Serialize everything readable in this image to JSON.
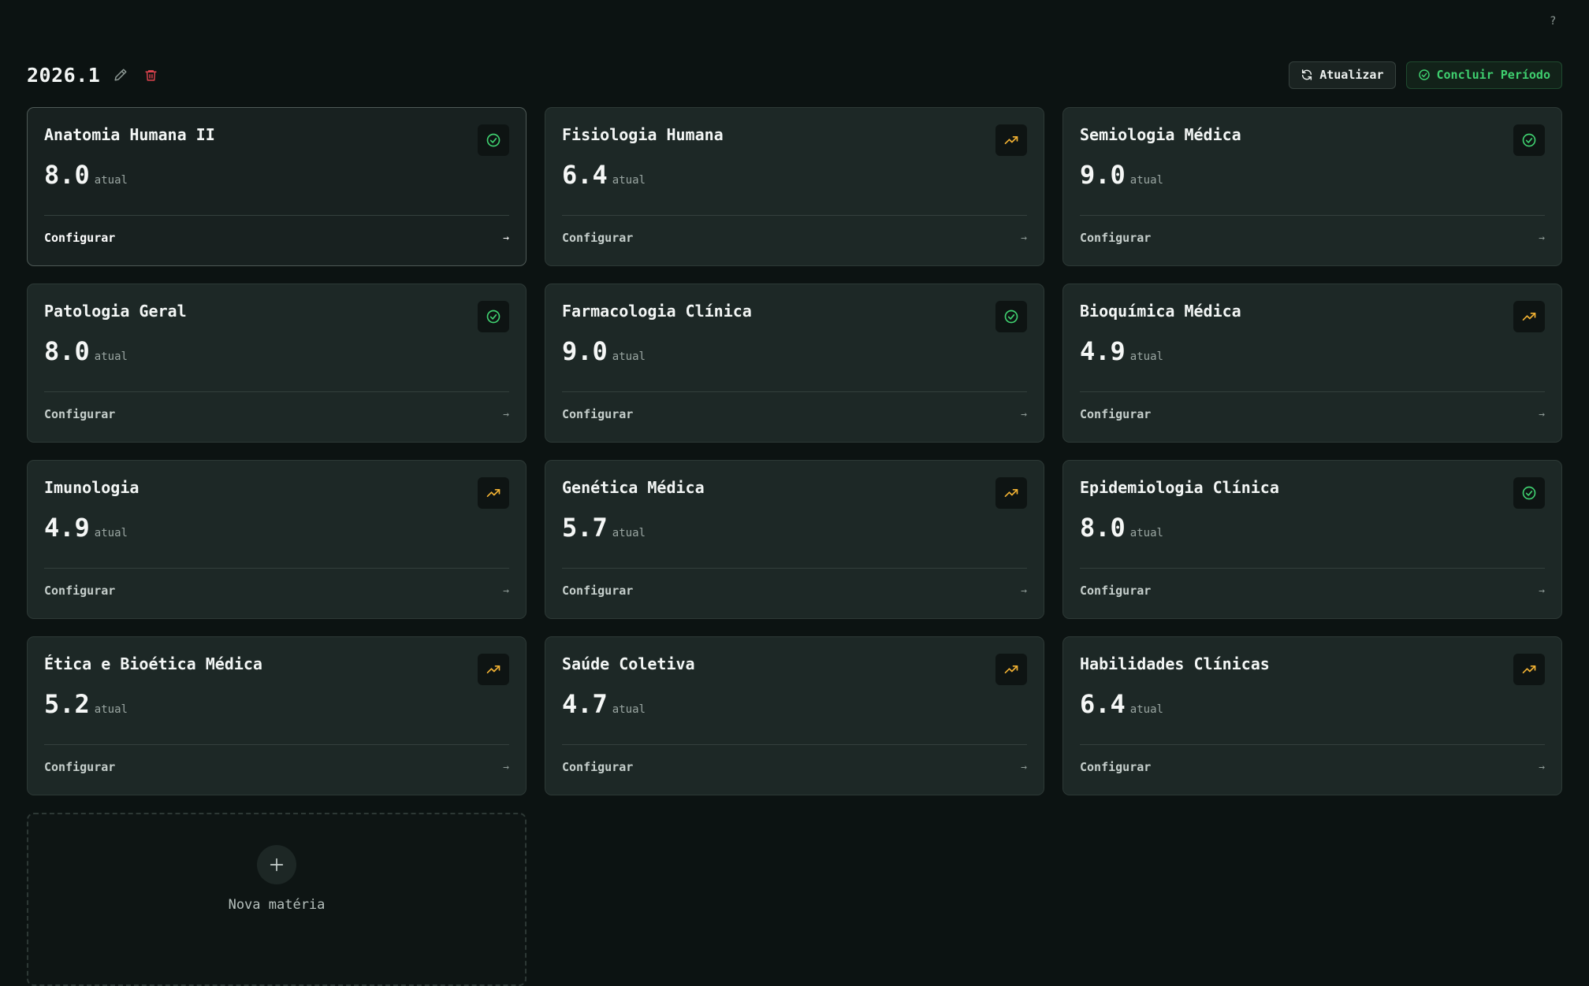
{
  "help_label": "?",
  "period": {
    "title": "2026.1"
  },
  "actions": {
    "refresh_label": "Atualizar",
    "conclude_label": "Concluir Período"
  },
  "config_label": "Configurar",
  "grade_unit": "atual",
  "colors": {
    "success": "#3fcf6f",
    "warning": "#f2b233",
    "danger": "#e0444f"
  },
  "subjects": [
    {
      "name": "Anatomia Humana II",
      "grade": "8.0",
      "status": "check-circle-icon"
    },
    {
      "name": "Fisiologia Humana",
      "grade": "6.4",
      "status": "trending-up-icon"
    },
    {
      "name": "Semiologia Médica",
      "grade": "9.0",
      "status": "check-circle-icon"
    },
    {
      "name": "Patologia Geral",
      "grade": "8.0",
      "status": "check-circle-icon"
    },
    {
      "name": "Farmacologia Clínica",
      "grade": "9.0",
      "status": "check-circle-icon"
    },
    {
      "name": "Bioquímica Médica",
      "grade": "4.9",
      "status": "trending-up-icon"
    },
    {
      "name": "Imunologia",
      "grade": "4.9",
      "status": "trending-up-icon"
    },
    {
      "name": "Genética Médica",
      "grade": "5.7",
      "status": "trending-up-icon"
    },
    {
      "name": "Epidemiologia Clínica",
      "grade": "8.0",
      "status": "check-circle-icon"
    },
    {
      "name": "Ética e Bioética Médica",
      "grade": "5.2",
      "status": "trending-up-icon"
    },
    {
      "name": "Saúde Coletiva",
      "grade": "4.7",
      "status": "trending-up-icon"
    },
    {
      "name": "Habilidades Clínicas",
      "grade": "6.4",
      "status": "trending-up-icon"
    }
  ],
  "new_subject_label": "Nova matéria"
}
